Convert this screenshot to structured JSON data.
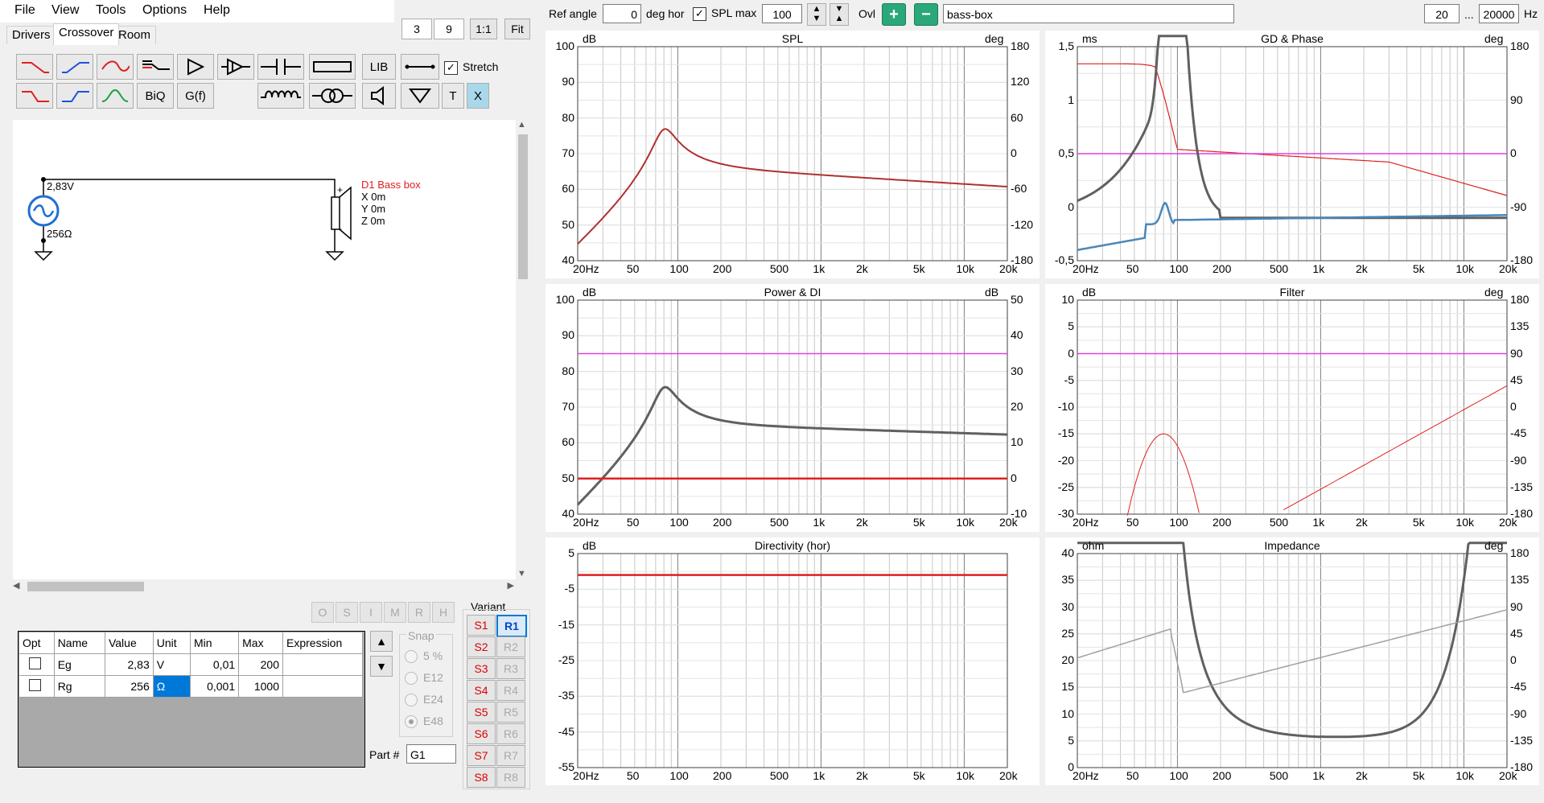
{
  "menu": [
    "File",
    "View",
    "Tools",
    "Options",
    "Help"
  ],
  "tabs": [
    "Drivers",
    "Crossover",
    "Room"
  ],
  "zoom_boxes": [
    "3",
    "9"
  ],
  "zoom_buttons": [
    "1:1",
    "Fit"
  ],
  "tool_labels": {
    "lib": "LIB",
    "biq": "BiQ",
    "gf": "G(f)",
    "t": "T",
    "x": "X"
  },
  "stretch_label": "Stretch",
  "schematic": {
    "source_voltage": "2,83V",
    "source_impedance": "256Ω",
    "driver_name": "D1 Bass box",
    "driver_x": "X 0m",
    "driver_y": "Y 0m",
    "driver_z": "Z 0m",
    "plus": "+",
    "minus": "-"
  },
  "oh_buttons": [
    "O",
    "S",
    "I",
    "M",
    "R",
    "H"
  ],
  "params": {
    "headers": [
      "Opt",
      "Name",
      "Value",
      "Unit",
      "Min",
      "Max",
      "Expression"
    ],
    "rows": [
      {
        "name": "Eg",
        "value": "2,83",
        "unit": "V",
        "min": "0,01",
        "max": "200",
        "expr": ""
      },
      {
        "name": "Rg",
        "value": "256",
        "unit": "Ω",
        "min": "0,001",
        "max": "1000",
        "expr": ""
      }
    ]
  },
  "snap": {
    "label": "Snap",
    "options": [
      "5 %",
      "E12",
      "E24",
      "E48"
    ],
    "selected": "E48"
  },
  "part": {
    "label": "Part #",
    "value": "G1"
  },
  "variant": {
    "label": "Variant",
    "s": [
      "S1",
      "S2",
      "S3",
      "S4",
      "S5",
      "S6",
      "S7",
      "S8"
    ],
    "r": [
      "R1",
      "R2",
      "R3",
      "R4",
      "R5",
      "R6",
      "R7",
      "R8"
    ]
  },
  "top": {
    "ref_angle_label": "Ref angle",
    "ref_angle": "0",
    "deg_hor": "deg hor",
    "spl_max_label": "SPL max",
    "spl_max": "100",
    "ovl": "Ovl",
    "project": "bass-box",
    "f_lo": "20",
    "dots": "...",
    "f_hi": "20000",
    "hz": "Hz"
  },
  "graphs": {
    "x_ticks": [
      "20Hz",
      "50",
      "100",
      "200",
      "500",
      "1k",
      "2k",
      "5k",
      "10k",
      "20k"
    ],
    "spl": {
      "title": "SPL",
      "left_unit": "dB",
      "right_unit": "deg",
      "left": [
        "100",
        "90",
        "80",
        "70",
        "60",
        "50",
        "40"
      ],
      "right": [
        "180",
        "120",
        "60",
        "0",
        "-60",
        "-120",
        "-180"
      ]
    },
    "gd": {
      "title": "GD & Phase",
      "left_unit": "ms",
      "right_unit": "deg",
      "left": [
        "1,5",
        "1",
        "0,5",
        "0",
        "-0,5"
      ],
      "right": [
        "180",
        "90",
        "0",
        "-90",
        "-180"
      ]
    },
    "power": {
      "title": "Power & DI",
      "left_unit": "dB",
      "right_unit": "dB",
      "left": [
        "100",
        "90",
        "80",
        "70",
        "60",
        "50",
        "40"
      ],
      "right": [
        "50",
        "40",
        "30",
        "20",
        "10",
        "0",
        "-10"
      ]
    },
    "filter": {
      "title": "Filter",
      "left_unit": "dB",
      "right_unit": "deg",
      "left": [
        "10",
        "5",
        "0",
        "-5",
        "-10",
        "-15",
        "-20",
        "-25",
        "-30"
      ],
      "right": [
        "180",
        "135",
        "90",
        "45",
        "0",
        "-45",
        "-90",
        "-135",
        "-180"
      ]
    },
    "directivity": {
      "title": "Directivity (hor)",
      "left_unit": "dB",
      "left": [
        "5",
        "-5",
        "-15",
        "-25",
        "-35",
        "-45",
        "-55"
      ]
    },
    "impedance": {
      "title": "Impedance",
      "left_unit": "ohm",
      "right_unit": "deg",
      "left": [
        "40",
        "35",
        "30",
        "25",
        "20",
        "15",
        "10",
        "5",
        "0"
      ],
      "right": [
        "180",
        "135",
        "90",
        "45",
        "0",
        "-45",
        "-90",
        "-135",
        "-180"
      ]
    }
  },
  "colors": {
    "dark_red": "#b03030",
    "red": "#e02020",
    "magenta": "#e040e0",
    "gray": "#606060",
    "blue": "#4a86b8",
    "light_gray": "#a0a0a0"
  }
}
